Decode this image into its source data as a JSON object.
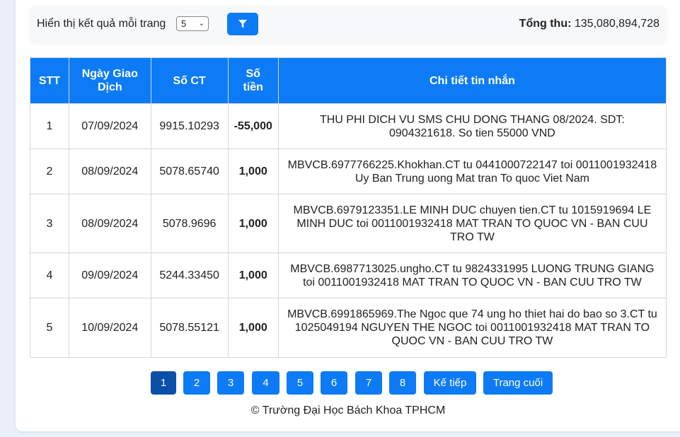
{
  "toolbar": {
    "per_page_label": "Hiển thị kết quả mỗi trang",
    "per_page_value": "5",
    "total_label": "Tổng thu:",
    "total_value": "135,080,894,728"
  },
  "table": {
    "headers": {
      "stt": "STT",
      "date_line1": "Ngày Giao",
      "date_line2": "Dịch",
      "doc_no": "Số CT",
      "amount_line1": "Số",
      "amount_line2": "tiền",
      "detail": "Chi tiết tin nhắn"
    },
    "rows": [
      {
        "stt": "1",
        "date": "07/09/2024",
        "doc_no": "9915.10293",
        "amount": "-55,000",
        "sign": "neg",
        "detail": [
          "THU PHI DICH VU SMS CHU DONG THANG 08/2024. SDT:",
          "0904321618. So tien 55000 VND"
        ]
      },
      {
        "stt": "2",
        "date": "08/09/2024",
        "doc_no": "5078.65740",
        "amount": "1,000",
        "sign": "pos",
        "detail": [
          "MBVCB.6977766225.Khokhan.CT tu 0441000722147 toi 0011001932418",
          "Uy Ban Trung uong Mat tran To quoc Viet Nam"
        ]
      },
      {
        "stt": "3",
        "date": "08/09/2024",
        "doc_no": "5078.9696",
        "amount": "1,000",
        "sign": "pos",
        "detail": [
          "MBVCB.6979123351.LE MINH DUC chuyen tien.CT tu 1015919694 LE",
          "MINH DUC toi 0011001932418 MAT TRAN TO QUOC VN - BAN CUU",
          "TRO TW"
        ]
      },
      {
        "stt": "4",
        "date": "09/09/2024",
        "doc_no": "5244.33450",
        "amount": "1,000",
        "sign": "pos",
        "detail": [
          "MBVCB.6987713025.ungho.CT tu 9824331995 LUONG TRUNG GIANG",
          "toi 0011001932418 MAT TRAN TO QUOC VN - BAN CUU TRO TW"
        ]
      },
      {
        "stt": "5",
        "date": "10/09/2024",
        "doc_no": "5078.55121",
        "amount": "1,000",
        "sign": "pos",
        "detail": [
          "MBVCB.6991865969.The Ngoc que 74 ung ho thiet hai do bao so 3.CT tu",
          "1025049194 NGUYEN THE NGOC toi 0011001932418 MAT TRAN TO",
          "QUOC VN - BAN CUU TRO TW"
        ]
      }
    ]
  },
  "pagination": {
    "pages": [
      "1",
      "2",
      "3",
      "4",
      "5",
      "6",
      "7",
      "8"
    ],
    "active": "1",
    "next_label": "Kế tiếp",
    "last_label": "Trang cuối"
  },
  "footer": {
    "text": "© Trường Đại Học Bách Khoa TPHCM"
  },
  "colors": {
    "primary": "#0d7bf5",
    "active_page": "#0a4fa8",
    "negative_amount": "#d0021b",
    "positive_amount": "#0d7bf5"
  },
  "icons": {
    "filter": "filter-icon",
    "select_chevron": "chevron-down-icon"
  }
}
